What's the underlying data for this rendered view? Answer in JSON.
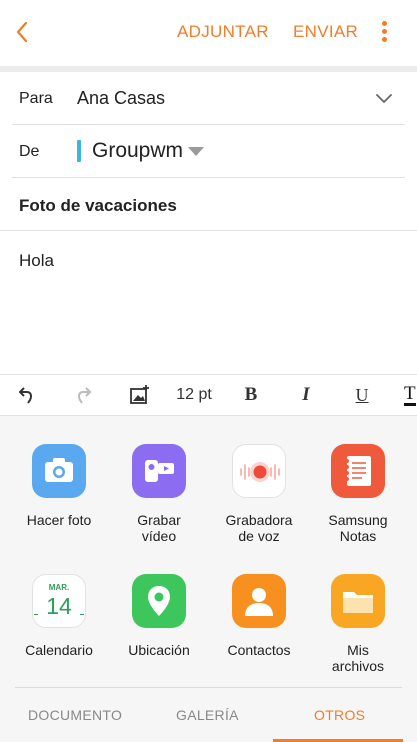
{
  "header": {
    "attach_label": "ADJUNTAR",
    "send_label": "ENVIAR",
    "accent": "#f07d2a"
  },
  "compose": {
    "to_label": "Para",
    "to_value": "Ana Casas",
    "from_label": "De",
    "from_value": "Groupwm",
    "subject": "Foto de vacaciones",
    "body": "Hola"
  },
  "toolbar": {
    "font_size": "12 pt",
    "bold": "B",
    "italic": "I",
    "underline": "U",
    "text_color": "T"
  },
  "attach_options": [
    {
      "label": "Hacer foto",
      "icon": "camera-icon"
    },
    {
      "label": "Grabar vídeo",
      "icon": "video-recorder-icon"
    },
    {
      "label": "Grabadora de voz",
      "icon": "voice-recorder-icon"
    },
    {
      "label": "Samsung Notas",
      "icon": "notes-icon"
    },
    {
      "label": "Calendario",
      "icon": "calendar-icon",
      "month": "MAR.",
      "day": "14"
    },
    {
      "label": "Ubicación",
      "icon": "location-icon"
    },
    {
      "label": "Contactos",
      "icon": "contacts-icon"
    },
    {
      "label": "Mis archivos",
      "icon": "folder-icon"
    }
  ],
  "tabs": [
    {
      "label": "DOCUMENTO",
      "active": false
    },
    {
      "label": "GALERÍA",
      "active": false
    },
    {
      "label": "OTROS",
      "active": true
    }
  ]
}
